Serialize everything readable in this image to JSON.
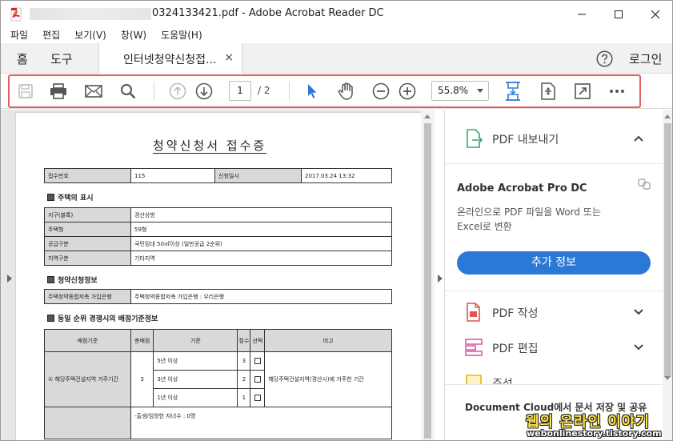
{
  "window": {
    "title_suffix": "0324133421.pdf - Adobe Acrobat Reader DC",
    "controls": [
      "minimize",
      "maximize",
      "close"
    ]
  },
  "menu": [
    "파일",
    "편집",
    "보기(V)",
    "창(W)",
    "도움말(H)"
  ],
  "tabs": {
    "home": "홈",
    "tools": "도구",
    "document": "인터넷청약신청접...",
    "close_symbol": "×",
    "login": "로그인"
  },
  "toolbar": {
    "page_current": "1",
    "page_total": "/ 2",
    "zoom": "55.8%",
    "icons": [
      "save-icon",
      "print-icon",
      "email-icon",
      "search-icon",
      "page-up-icon",
      "page-down-icon",
      "select-arrow-icon",
      "hand-tool-icon",
      "zoom-out-icon",
      "zoom-in-icon",
      "fit-page-icon",
      "rotate-icon",
      "full-screen-icon",
      "more-icon"
    ],
    "highlight_color": "#e25f5f"
  },
  "pdf": {
    "title": "청약신청서 접수증",
    "header_rows": [
      [
        "접수번호",
        "115",
        "신청일시",
        "2017.03.24 13:32"
      ]
    ],
    "section1": "주택의 표시",
    "housing": [
      [
        "지구(블록)",
        "경산상방"
      ],
      [
        "주택형",
        "59형"
      ],
      [
        "공급구분",
        "국민임대 50㎡이상 (일반공급 2순위)"
      ],
      [
        "지역구분",
        "기타지역"
      ]
    ],
    "section2": "청약신청정보",
    "account": [
      "주택청약종합저축 가입은행",
      "주택청약종합저축 가입은행 : 우리은행"
    ],
    "section3": "동일 순위 경쟁시의 배점기준정보",
    "criteria_headers": [
      "배점기준",
      "총배점",
      "기준",
      "점수",
      "선택",
      "비고"
    ],
    "criteria_group": "① 해당주택건설지역 거주기간",
    "criteria_total": "3",
    "criteria_rows": [
      [
        "5년 이상",
        "3"
      ],
      [
        "3년 이상",
        "2"
      ],
      [
        "1년 이상",
        "1"
      ]
    ],
    "criteria_note": "해당주택건설지역(경산시)에 거주한 기간",
    "extra_text": "-출생/임양한 자녀수 : 0명"
  },
  "right_pane": {
    "export": "PDF 내보내기",
    "product": "Adobe Acrobat Pro DC",
    "desc": "온라인으로 PDF 파일을 Word 또는 Excel로 변환",
    "button": "추가 정보",
    "create": "PDF 작성",
    "edit": "PDF 편집",
    "comment": "주석",
    "cloud": "Document Cloud에서 문서 저장 및 공유",
    "accent": "#2b79d6"
  },
  "watermark": {
    "main": "웹의 온라인 이야기",
    "sub": "webonlinestory.tistory.com"
  }
}
